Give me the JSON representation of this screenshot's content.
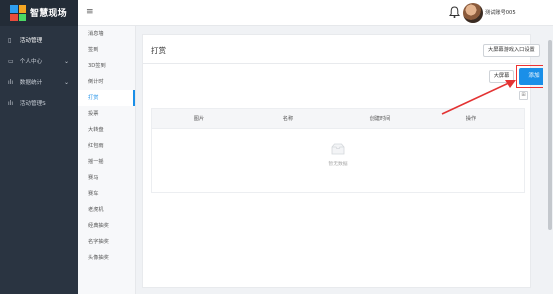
{
  "app": {
    "title": "智慧现场",
    "logo_colors": [
      "#2e9ef0",
      "#f5a623",
      "#e84c3d",
      "#4cd964"
    ]
  },
  "sidebar": {
    "items": [
      {
        "label": "活动管理",
        "icon": "clipboard-icon",
        "glyph": "▯",
        "active": true,
        "has_chevron": false
      },
      {
        "label": "个人中心",
        "icon": "user-card-icon",
        "glyph": "▭",
        "active": false,
        "has_chevron": true
      },
      {
        "label": "数据统计",
        "icon": "chart-icon",
        "glyph": "ılı",
        "active": false,
        "has_chevron": true
      },
      {
        "label": "活动管理S",
        "icon": "activity-icon",
        "glyph": "ılı",
        "active": false,
        "has_chevron": false
      }
    ]
  },
  "submenu": {
    "items": [
      {
        "label": "消息墙",
        "active": false
      },
      {
        "label": "签到",
        "active": false
      },
      {
        "label": "3D签到",
        "active": false
      },
      {
        "label": "倒计时",
        "active": false
      },
      {
        "label": "打赏",
        "active": true
      },
      {
        "label": "投票",
        "active": false
      },
      {
        "label": "大转盘",
        "active": false
      },
      {
        "label": "红包雨",
        "active": false
      },
      {
        "label": "摇一摇",
        "active": false
      },
      {
        "label": "赛马",
        "active": false
      },
      {
        "label": "赛车",
        "active": false
      },
      {
        "label": "老虎机",
        "active": false
      },
      {
        "label": "经典抽奖",
        "active": false
      },
      {
        "label": "名字抽奖",
        "active": false
      },
      {
        "label": "头像抽奖",
        "active": false
      }
    ]
  },
  "header": {
    "menu_icon": "≡",
    "bell_icon": "bell-icon",
    "user_name": "测试账号005"
  },
  "main": {
    "title": "打赏",
    "buttons": {
      "big_screen_setting": "大屏幕游戏入口设置",
      "big_screen": "大屏幕",
      "add": "添加"
    },
    "grid_toggle": "⊞",
    "table": {
      "columns": [
        "图片",
        "名称",
        "创建时间",
        "操作"
      ],
      "empty_text": "暂无数据"
    }
  },
  "colors": {
    "accent": "#1a8fe8",
    "annotation_red": "#e33333",
    "sidebar_bg": "#2a3441"
  }
}
